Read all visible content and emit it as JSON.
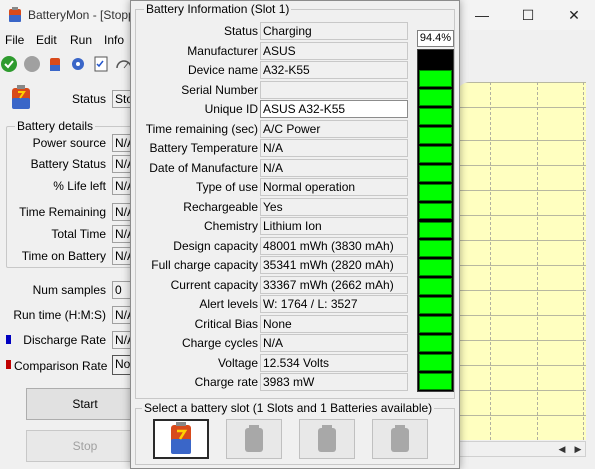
{
  "window": {
    "title": "BatteryMon - [Stopp",
    "minimize": "—",
    "maximize": "☐",
    "close": "✕"
  },
  "menu": [
    "File",
    "Edit",
    "Run",
    "Info"
  ],
  "main": {
    "status_label": "Status",
    "status_value": "Sto",
    "group_title": "Battery details",
    "fields": [
      {
        "label": "Power source",
        "value": "N/A"
      },
      {
        "label": "Battery Status",
        "value": "N/A"
      },
      {
        "label": "% Life left",
        "value": "N/A"
      },
      {
        "label": "Time Remaining",
        "value": "N/A"
      },
      {
        "label": "Total Time",
        "value": "N/A"
      },
      {
        "label": "Time on Battery",
        "value": "N/A"
      }
    ],
    "num_samples_label": "Num samples",
    "num_samples_value": "0",
    "run_time_label": "Run time (H:M:S)",
    "run_time_value": "N/A",
    "discharge_label": "Discharge Rate",
    "discharge_value": "N/A",
    "comparison_label": "Comparison Rate",
    "comparison_value": "No",
    "start_button": "Start",
    "stop_button": "Stop",
    "discharge_color": "#0000c0",
    "comparison_color": "#c00000"
  },
  "dialog": {
    "group_title": "Battery Information (Slot 1)",
    "rows": [
      {
        "label": "Status",
        "value": "Charging",
        "field": false
      },
      {
        "label": "Manufacturer",
        "value": "ASUS",
        "field": false
      },
      {
        "label": "Device name",
        "value": "A32-K55",
        "field": false
      },
      {
        "label": "Serial Number",
        "value": "",
        "field": false
      },
      {
        "label": "Unique ID",
        "value": "ASUS A32-K55",
        "field": true
      },
      {
        "label": "Time remaining (sec)",
        "value": "A/C Power",
        "field": false
      },
      {
        "label": "Battery Temperature",
        "value": "N/A",
        "field": false
      },
      {
        "label": "Date of Manufacture",
        "value": "N/A",
        "field": false
      },
      {
        "label": "Type of use",
        "value": "Normal operation",
        "field": false
      },
      {
        "label": "Rechargeable",
        "value": "Yes",
        "field": false
      },
      {
        "label": "Chemistry",
        "value": "Lithium Ion",
        "field": false
      },
      {
        "label": "Design capacity",
        "value": "48001 mWh (3830 mAh)",
        "field": false
      },
      {
        "label": "Full charge capacity",
        "value": "35341 mWh (2820 mAh)",
        "field": false
      },
      {
        "label": "Current capacity",
        "value": "33367 mWh (2662 mAh)",
        "field": false
      },
      {
        "label": "Alert levels",
        "value": "W: 1764 / L: 3527",
        "field": false
      },
      {
        "label": "Critical Bias",
        "value": "None",
        "field": false
      },
      {
        "label": "Charge cycles",
        "value": "N/A",
        "field": false
      },
      {
        "label": "Voltage",
        "value": "12.534 Volts",
        "field": false
      },
      {
        "label": "Charge rate",
        "value": "3983 mW",
        "field": false
      }
    ],
    "level_text": "94.4%",
    "level_fraction": 0.944,
    "level_color": "#00ff00",
    "slot_group_title": "Select a battery slot (1 Slots and 1 Batteries available)",
    "slots": [
      {
        "icon": "battery-slot-active-icon",
        "active": true
      },
      {
        "icon": "battery-slot-empty-icon",
        "active": false
      },
      {
        "icon": "battery-slot-empty-icon",
        "active": false
      },
      {
        "icon": "battery-slot-empty-icon",
        "active": false
      }
    ]
  }
}
